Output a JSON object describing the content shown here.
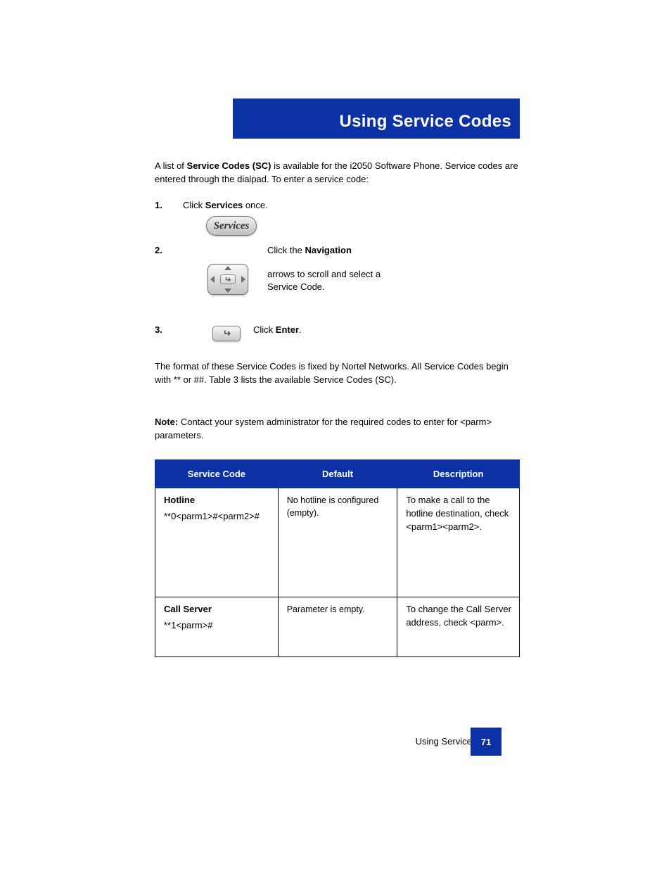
{
  "title": "Using Service Codes",
  "lead": {
    "prefix": "A list of ",
    "bold": "Service Codes (SC)",
    "suffix": " is available for the i2050 Software Phone. Service codes are entered through the dialpad. To enter a service code:"
  },
  "buttons": {
    "services_label": "Services"
  },
  "steps": [
    {
      "num": "1.",
      "text_before": "Click ",
      "bold": "Services",
      "text_after": " once.",
      "img_after": "."
    },
    {
      "num": "2.",
      "line1_pre": "Click the ",
      "line1_bold": "Navigation",
      "line1_post": "",
      "line2": "arrows to scroll and select a",
      "line3": "Service Code."
    },
    {
      "num": "3.",
      "pre": "Click ",
      "bold": "Enter",
      "post": "."
    }
  ],
  "format_para": "The format of these Service Codes is fixed by Nortel Networks. All Service Codes begin with ** or ##. Table 3 lists the available Service Codes (SC).",
  "note_para": {
    "bold": "Note:",
    "rest": " Contact your system administrator for the required codes to enter for <parm> parameters."
  },
  "table": {
    "headers": [
      "Service Code",
      "Default",
      "Description"
    ],
    "rows": [
      {
        "title": "Hotline",
        "body": "**0<parm1>#<parm2>#",
        "default": "No hotline is configured (empty).",
        "desc": "To make a call to the hotline destination, check <parm1><parm2>."
      },
      {
        "title": "Call Server",
        "body": "**1<parm>#",
        "default": "Parameter is empty.",
        "desc": "To change the Call Server address, check <parm>."
      }
    ]
  },
  "footer": {
    "section": "Using Service Codes",
    "page": "71"
  }
}
